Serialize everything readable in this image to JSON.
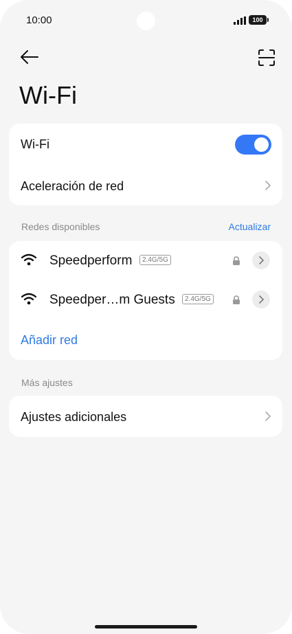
{
  "status_bar": {
    "time": "10:00",
    "battery": "100"
  },
  "header": {
    "title": "Wi-Fi"
  },
  "wifi_card": {
    "wifi_label": "Wi-Fi",
    "wifi_on": true,
    "accel_label": "Aceleración de red"
  },
  "available": {
    "section_label": "Redes disponibles",
    "refresh_label": "Actualizar",
    "networks": [
      {
        "name": "Speedperform",
        "band": "2.4G/5G"
      },
      {
        "name": "Speedper…m Guests",
        "band": "2.4G/5G"
      }
    ],
    "add_label": "Añadir red"
  },
  "more": {
    "section_label": "Más ajustes",
    "extra_label": "Ajustes adicionales"
  },
  "colors": {
    "accent": "#3478f6",
    "link": "#2f7be0",
    "background": "#f5f5f5"
  }
}
